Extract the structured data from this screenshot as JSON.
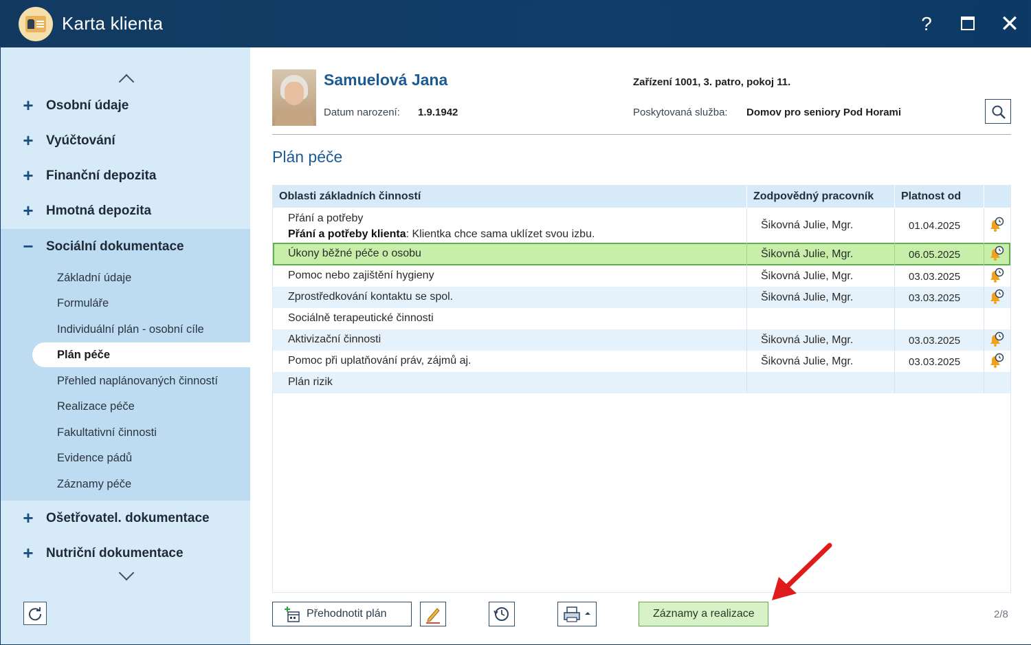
{
  "window": {
    "title": "Karta klienta",
    "help_label": "?",
    "close_label": "✕"
  },
  "sidebar": {
    "items": [
      {
        "label": "Osobní údaje",
        "sign": "+"
      },
      {
        "label": "Vyúčtování",
        "sign": "+"
      },
      {
        "label": "Finanční depozita",
        "sign": "+"
      },
      {
        "label": "Hmotná depozita",
        "sign": "+"
      },
      {
        "label": "Sociální dokumentace",
        "sign": "−"
      },
      {
        "label": "Ošetřovatel. dokumentace",
        "sign": "+"
      },
      {
        "label": "Nutriční dokumentace",
        "sign": "+"
      }
    ],
    "sub_items": [
      "Základní údaje",
      "Formuláře",
      "Individuální plán - osobní cíle",
      "Plán péče",
      "Přehled naplánovaných činností",
      "Realizace péče",
      "Fakultativní činnosti",
      "Evidence pádů",
      "Záznamy péče"
    ],
    "active_sub": "Plán péče"
  },
  "client": {
    "name": "Samuelová Jana",
    "dob_label": "Datum narození:",
    "dob": "1.9.1942",
    "location": "Zařízení 1001, 3. patro, pokoj 11.",
    "service_label": "Poskytovaná služba:",
    "service": "Domov pro seniory Pod Horami"
  },
  "section_title": "Plán péče",
  "table": {
    "headers": [
      "Oblasti základních činností",
      "Zodpovědný pracovník",
      "Platnost od"
    ],
    "rows": [
      {
        "area": "Přání a potřeby",
        "note_bold": "Přání a potřeby klienta",
        "note": ": Klientka chce sama uklízet svou izbu.",
        "worker": "Šikovná Julie, Mgr.",
        "valid_from": "01.04.2025",
        "icon": "bell-clock-icon"
      },
      {
        "area": "Úkony běžné péče o osobu",
        "worker": "Šikovná Julie, Mgr.",
        "valid_from": "06.05.2025",
        "icon": "bell-clock-icon",
        "selected": true
      },
      {
        "area": "Pomoc nebo zajištění hygieny",
        "worker": "Šikovná Julie, Mgr.",
        "valid_from": "03.03.2025",
        "icon": "bell-clock-icon"
      },
      {
        "area": "Zprostředkování kontaktu se spol.",
        "worker": "Šikovná Julie, Mgr.",
        "valid_from": "03.03.2025",
        "icon": "bell-clock-icon"
      },
      {
        "area": "Sociálně terapeutické činnosti",
        "worker": "",
        "valid_from": "",
        "icon": ""
      },
      {
        "area": "Aktivizační činnosti",
        "worker": "Šikovná Julie, Mgr.",
        "valid_from": "03.03.2025",
        "icon": "bell-clock-icon"
      },
      {
        "area": "Pomoc při uplatňování práv, zájmů aj.",
        "worker": "Šikovná Julie, Mgr.",
        "valid_from": "03.03.2025",
        "icon": "bell-clock-icon"
      },
      {
        "area": "Plán rizik",
        "worker": "",
        "valid_from": "",
        "icon": ""
      }
    ]
  },
  "toolbar": {
    "replan_label": "Přehodnotit plán",
    "records_label": "Záznamy a realizace",
    "pager": "2/8"
  },
  "colors": {
    "titlebar": "#123a61",
    "sidebar_bg": "#d6eaf8",
    "accent_text": "#1c5a92",
    "selected_row": "#c7efaa",
    "annotation_arrow": "#e01b1b"
  }
}
